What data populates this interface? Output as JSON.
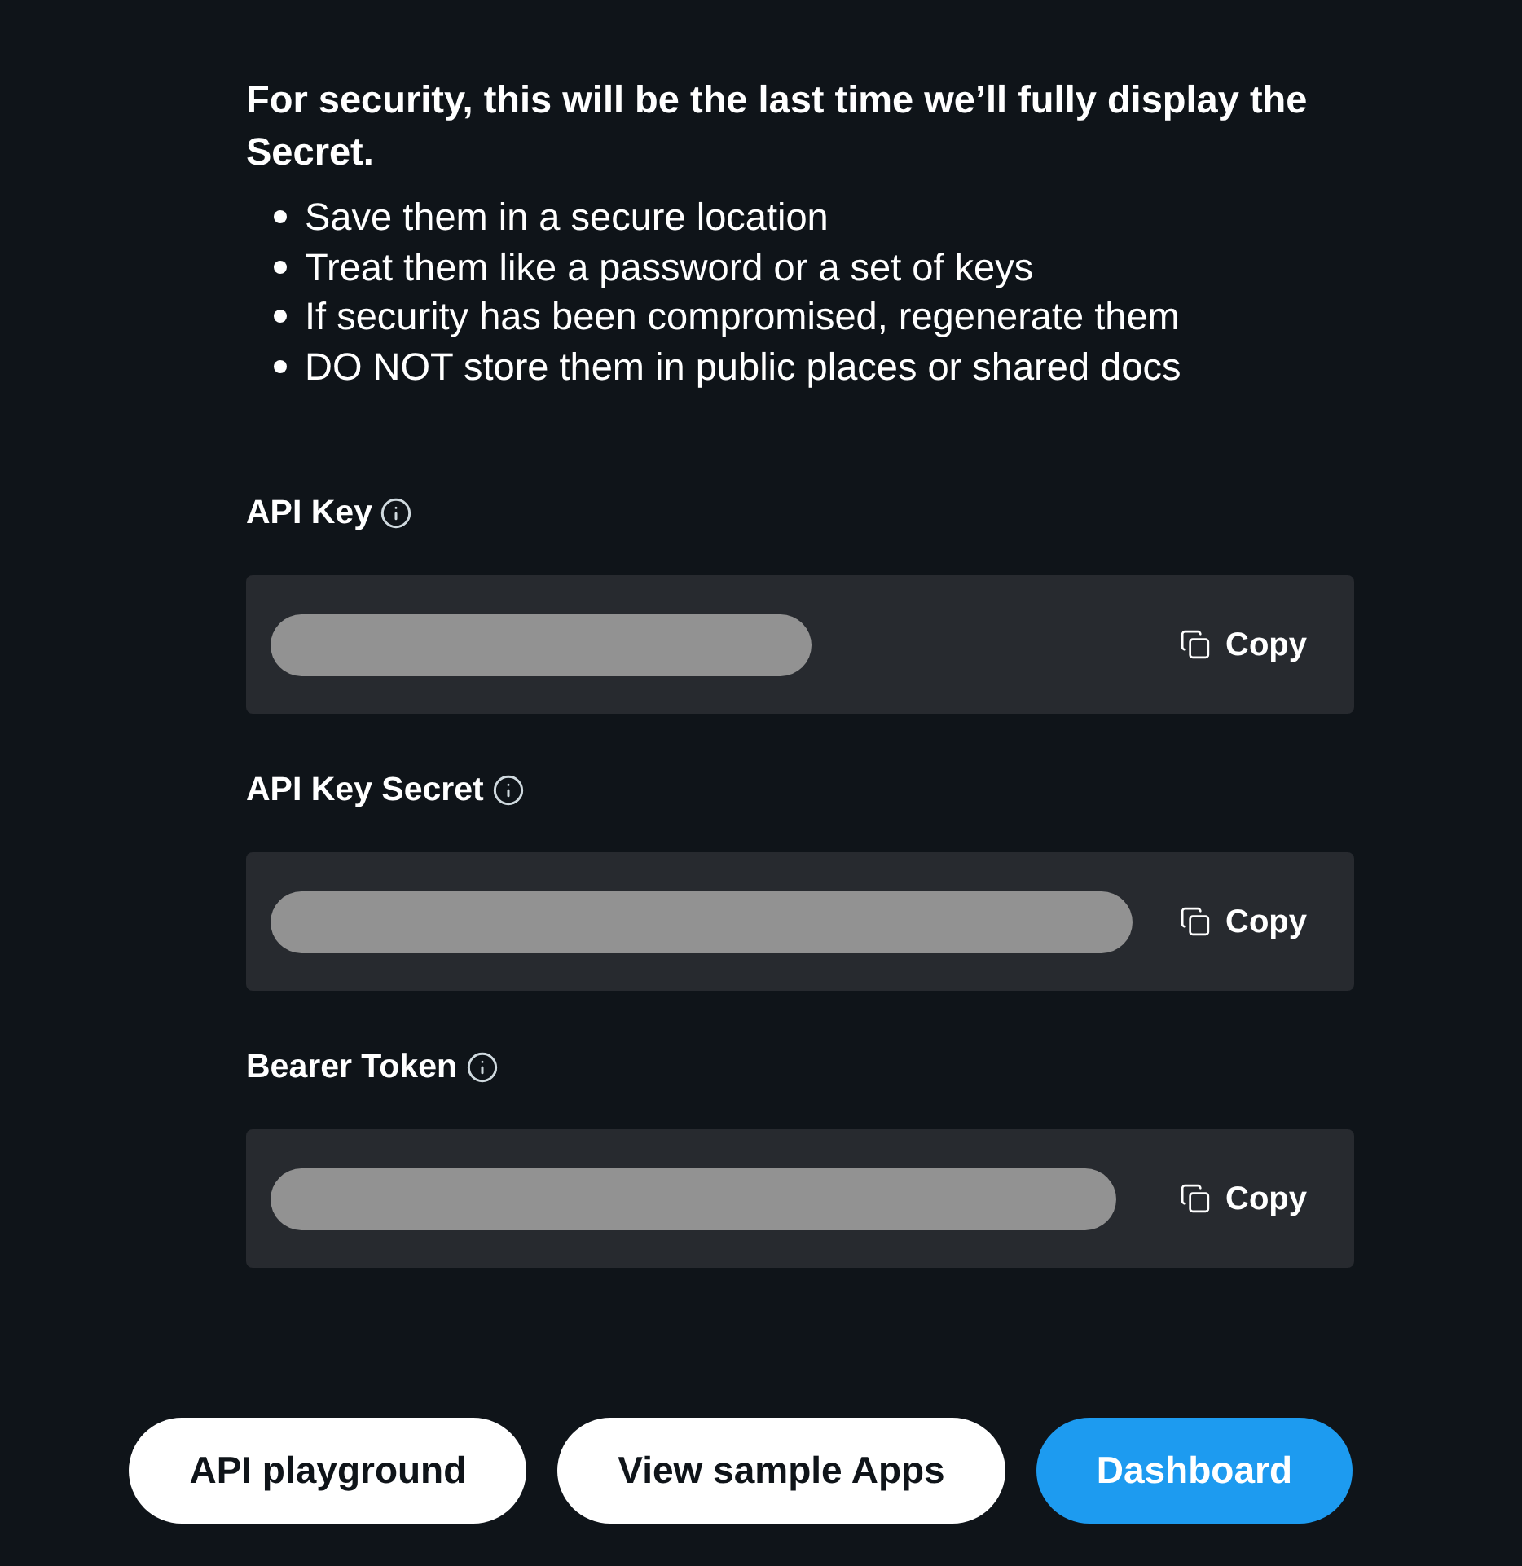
{
  "notice": {
    "heading": "For security, this will be the last time we’ll fully display the Secret.",
    "tips": [
      "Save them in a secure location",
      "Treat them like a password or a set of keys",
      "If security has been compromised, regenerate them",
      "DO NOT store them in public places or shared docs"
    ]
  },
  "credentials": [
    {
      "label": "API Key",
      "copy_label": "Copy"
    },
    {
      "label": "API Key Secret",
      "copy_label": "Copy"
    },
    {
      "label": "Bearer Token",
      "copy_label": "Copy"
    }
  ],
  "actions": [
    {
      "label": "API playground",
      "kind": "secondary"
    },
    {
      "label": "View sample Apps",
      "kind": "secondary"
    },
    {
      "label": "Dashboard",
      "kind": "primary"
    }
  ]
}
